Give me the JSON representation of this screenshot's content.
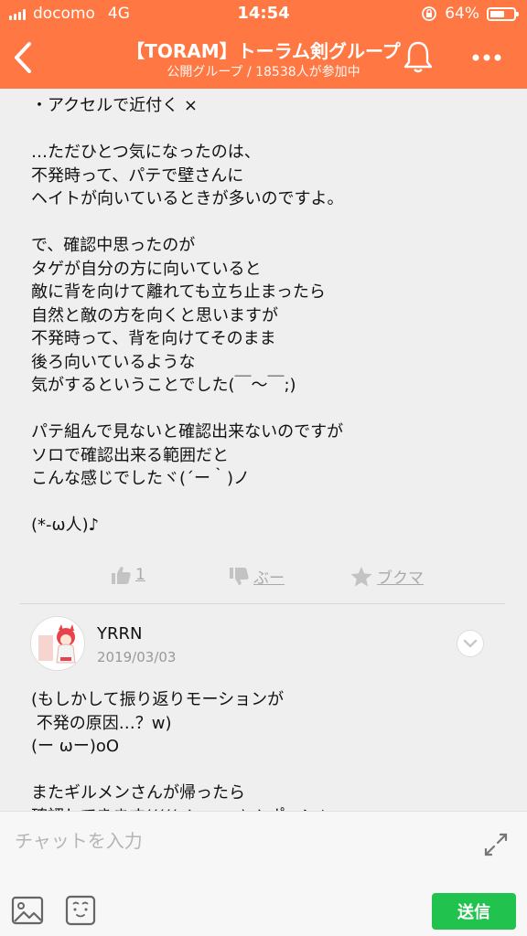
{
  "status_bar": {
    "carrier": "docomo",
    "network": "4G",
    "time": "14:54",
    "battery_percent": "64%",
    "battery_level": 0.64
  },
  "header": {
    "title": "【TORAM】トーラム剣グループ",
    "subtitle": "公開グループ / 18538人が参加中",
    "background_color": "#ff7742"
  },
  "post": {
    "text": "・アクセルで近付く ×\n\n…ただひとつ気になったのは、\n不発時って、パテで壁さんに\nヘイトが向いているときが多いのですよ。\n\nで、確認中思ったのが\nタゲが自分の方に向いていると\n敵に背を向けて離れても立ち止まったら\n自然と敵の方を向くと思いますが\n不発時って、背を向けてそのまま\n後ろ向いているような\n気がするということでした(￣～￣;)\n\nパテ組んで見ないと確認出来ないのですが\nソロで確認出来る範囲だと\nこんな感じでしたヾ(´ー｀)ノ\n\n(*-ω人)♪",
    "like_count": "1",
    "boo_label": "ぶー",
    "bookmark_label": "ブクマ"
  },
  "reply": {
    "user": "YRRN",
    "date": "2019/03/03",
    "text": "(もしかして振り返りモーションが\n 不発の原因…？w)\n(ー ωー)oO\n\nまたギルメンさんが帰ったら\n確認してきます(((((ノ・ω・)ノ ポーン♪"
  },
  "chat": {
    "placeholder": "チャットを入力",
    "send_label": "送信",
    "send_color": "#22c24e"
  }
}
